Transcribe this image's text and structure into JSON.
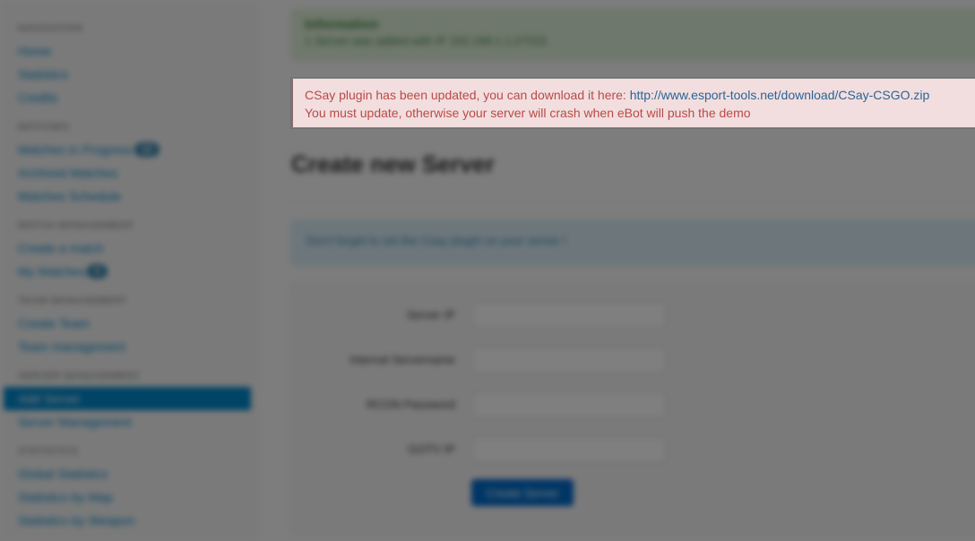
{
  "sidebar": {
    "sections": [
      {
        "header": "Navigation",
        "items": [
          {
            "label": "Home"
          },
          {
            "label": "Statistics"
          },
          {
            "label": "Credits"
          }
        ]
      },
      {
        "header": "Matches",
        "items": [
          {
            "label": "Matches in Progress",
            "badge": "12"
          },
          {
            "label": "Archived Matches"
          },
          {
            "label": "Matches Schedule"
          }
        ]
      },
      {
        "header": "Match Management",
        "items": [
          {
            "label": "Create a match"
          },
          {
            "label": "My Matches",
            "badge": "0"
          }
        ]
      },
      {
        "header": "Team Management",
        "items": [
          {
            "label": "Create Team"
          },
          {
            "label": "Team management"
          }
        ]
      },
      {
        "header": "Server Management",
        "items": [
          {
            "label": "Add Server",
            "active": true
          },
          {
            "label": "Server Management"
          }
        ]
      },
      {
        "header": "Statistics",
        "items": [
          {
            "label": "Global Statistics"
          },
          {
            "label": "Statistics by Map"
          },
          {
            "label": "Statistics by Weapon"
          }
        ]
      }
    ]
  },
  "main": {
    "info_alert": {
      "title": "Information",
      "message": "1 Server was added with IP 192.168.1.1:27015"
    },
    "error_alert": {
      "line1_prefix": "CSay plugin has been updated, you can download it here: ",
      "line1_link": "http://www.esport-tools.net/download/CSay-CSGO.zip",
      "line2": "You must update, otherwise your server will crash when eBot will push the demo"
    },
    "page_title": "Create new Server",
    "help_text": "Don't forget to set the Csay plugin on your server !",
    "form": {
      "fields": [
        {
          "label": "Server IP",
          "value": ""
        },
        {
          "label": "Internal Servername",
          "value": ""
        },
        {
          "label": "RCON Password",
          "value": ""
        },
        {
          "label": "GOTV IP",
          "value": ""
        }
      ],
      "submit_label": "Create Server"
    }
  },
  "colors": {
    "accent": "#0088cc",
    "error_text": "#b94a48",
    "error_bg": "#f2dede",
    "link": "#2a6496"
  }
}
